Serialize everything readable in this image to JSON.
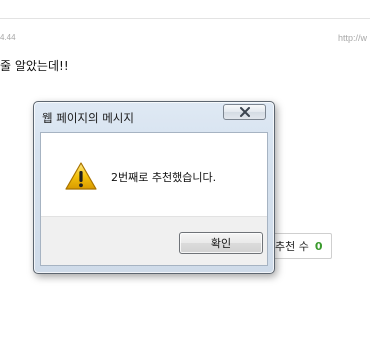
{
  "page": {
    "meta_left": "4.44",
    "meta_right": "http://w",
    "post_text": "줄 알았는데!!",
    "recommend": {
      "label": "추천 수",
      "count": "0"
    }
  },
  "dialog": {
    "title": "웹 페이지의 메시지",
    "message": "2번째로 추천했습니다.",
    "ok_label": "확인",
    "icons": {
      "close": "close-icon",
      "warning": "warning-icon"
    }
  },
  "colors": {
    "recommend_count": "#3a9a2d",
    "warning_fill": "#f4c20d",
    "dialog_frame": "#d6e2ef"
  }
}
